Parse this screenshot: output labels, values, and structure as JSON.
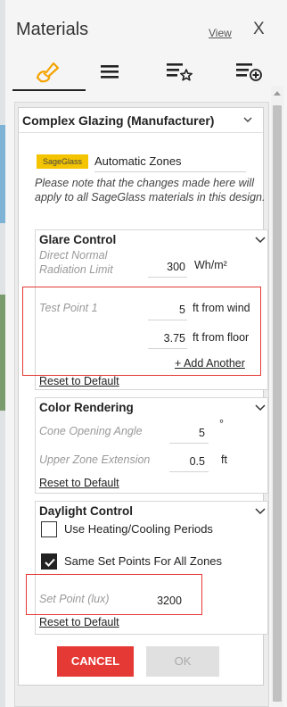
{
  "header": {
    "title": "Materials",
    "view_link": "View",
    "close_label": "X"
  },
  "tabs": [
    {
      "icon": "brush-icon",
      "active": true
    },
    {
      "icon": "list-icon",
      "active": false
    },
    {
      "icon": "list-star-icon",
      "active": false
    },
    {
      "icon": "list-add-icon",
      "active": false
    }
  ],
  "card": {
    "title": "Complex Glazing (Manufacturer)",
    "brand_badge": "SageGlass",
    "zone_mode": "Automatic Zones",
    "note": "Please note that the changes made here will apply to all SageGlass materials in this design."
  },
  "glare_control": {
    "title": "Glare Control",
    "radiation_label": "Direct Normal Radiation Limit",
    "radiation_value": "300",
    "radiation_unit": "Wh/m²",
    "test_point_label": "Test Point 1",
    "window_distance": "5",
    "window_unit": "ft from wind",
    "floor_distance": "3.75",
    "floor_unit": "ft from floor",
    "add_another": "+ Add Another",
    "reset": "Reset to Default"
  },
  "color_rendering": {
    "title": "Color Rendering",
    "cone_label": "Cone Opening Angle",
    "cone_value": "5",
    "cone_unit": "°",
    "upper_label": "Upper Zone Extension",
    "upper_value": "0.5",
    "upper_unit": "ft",
    "reset": "Reset to Default"
  },
  "daylight_control": {
    "title": "Daylight Control",
    "heating_cooling_label": "Use Heating/Cooling Periods",
    "heating_cooling_checked": false,
    "same_set_points_label": "Same Set Points For All Zones",
    "same_set_points_checked": true,
    "set_point_label": "Set Point (lux)",
    "set_point_value": "3200",
    "reset": "Reset to Default"
  },
  "buttons": {
    "cancel": "CANCEL",
    "ok": "OK"
  },
  "colors": {
    "accent_red": "#e53935",
    "badge_yellow": "#f4c400",
    "brush_icon_orange": "#f4a300"
  }
}
